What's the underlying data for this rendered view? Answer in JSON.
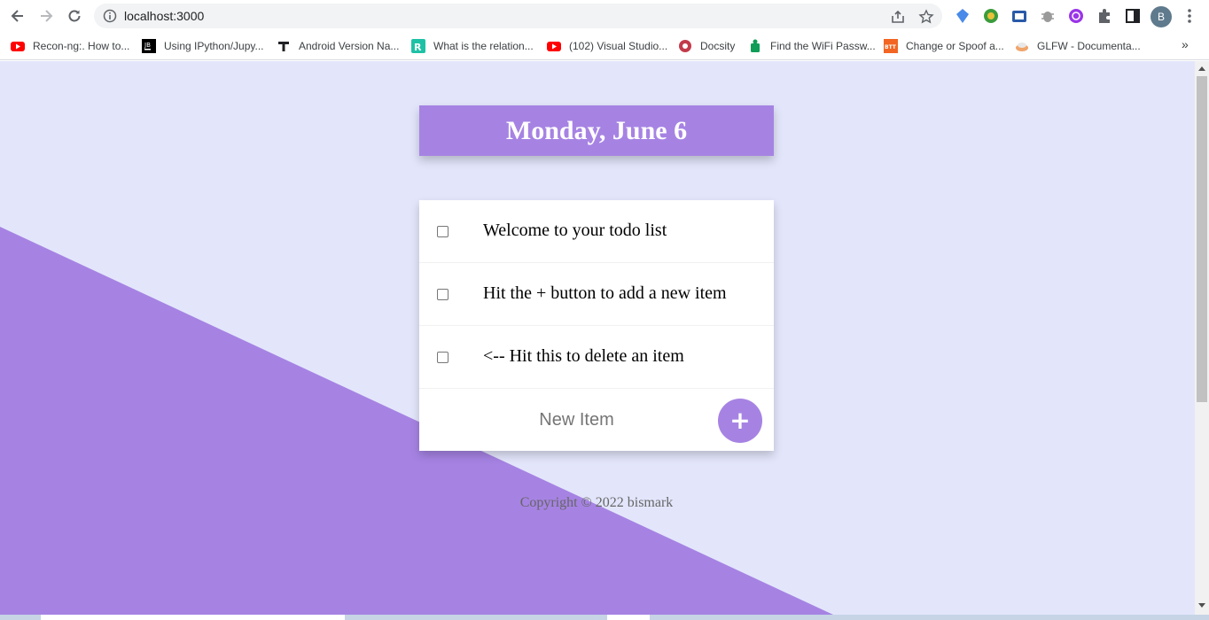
{
  "browser": {
    "url": "localhost:3000",
    "profile_initial": "B",
    "bookmarks": [
      {
        "label": "Recon-ng:. How to...",
        "icon": "youtube-icon"
      },
      {
        "label": "Using IPython/Jupy...",
        "icon": "jetbrains-icon"
      },
      {
        "label": "Android Version Na...",
        "icon": "t-icon"
      },
      {
        "label": "What is the relation...",
        "icon": "r-icon"
      },
      {
        "label": "(102) Visual Studio...",
        "icon": "youtube-icon"
      },
      {
        "label": "Docsity",
        "icon": "docsity-icon"
      },
      {
        "label": "Find the WiFi Passw...",
        "icon": "android-icon"
      },
      {
        "label": "Change or Spoof a...",
        "icon": "btt-icon"
      },
      {
        "label": "GLFW - Documenta...",
        "icon": "glfw-icon"
      }
    ],
    "bookmarks_overflow": "»"
  },
  "app": {
    "date_heading": "Monday, June 6",
    "items": [
      {
        "text": "Welcome to your todo list",
        "checked": false
      },
      {
        "text": "Hit the + button to add a new item",
        "checked": false
      },
      {
        "text": "<-- Hit this to delete an item",
        "checked": false
      }
    ],
    "new_item_placeholder": "New Item",
    "add_button_label": "+",
    "footer": "Copyright © 2022 bismark"
  },
  "colors": {
    "accent": "#a683e3",
    "background": "#e3e6fb"
  }
}
